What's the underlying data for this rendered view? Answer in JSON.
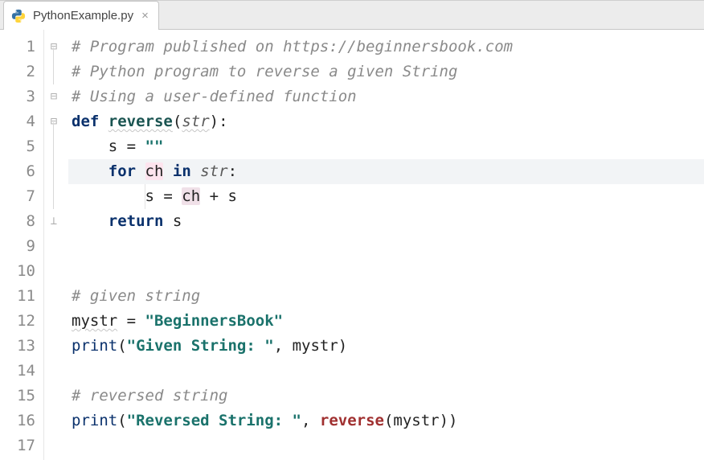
{
  "tab": {
    "filename": "PythonExample.py",
    "close_glyph": "×"
  },
  "gutter": {
    "lines": [
      "1",
      "2",
      "3",
      "4",
      "5",
      "6",
      "7",
      "8",
      "9",
      "10",
      "11",
      "12",
      "13",
      "14",
      "15",
      "16",
      "17"
    ],
    "highlighted_line": 6
  },
  "code": {
    "l1_comment": "# Program published on https://beginnersbook.com",
    "l2_comment": "# Python program to reverse a given String",
    "l3_comment": "# Using a user-defined function",
    "l4_def": "def",
    "l4_name": "reverse",
    "l4_paren_open": "(",
    "l4_param": "str",
    "l4_paren_close": "):",
    "l5_s": "s",
    "l5_eq": " = ",
    "l5_str": "\"\"",
    "l6_for": "for",
    "l6_ch": "ch",
    "l6_in": "in",
    "l6_str": "str",
    "l6_colon": ":",
    "l7_s": "s",
    "l7_eq": " = ",
    "l7_ch": "ch",
    "l7_plus": " + s",
    "l8_return": "return",
    "l8_s": " s",
    "l11_comment": "# given string",
    "l12_var": "mystr",
    "l12_eq": " = ",
    "l12_str": "\"BeginnersBook\"",
    "l13_print": "print",
    "l13_open": "(",
    "l13_str": "\"Given String: \"",
    "l13_rest": ", mystr)",
    "l15_comment": "# reversed string",
    "l16_print": "print",
    "l16_open": "(",
    "l16_str": "\"Reversed String: \"",
    "l16_comma": ", ",
    "l16_call": "reverse",
    "l16_args": "(mystr))"
  }
}
